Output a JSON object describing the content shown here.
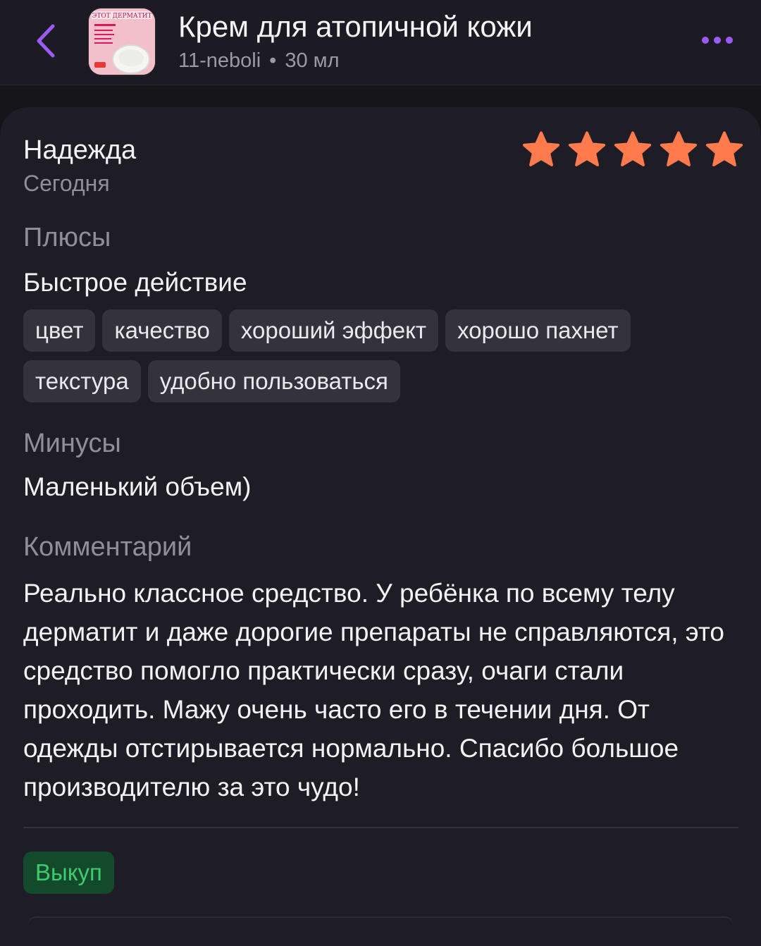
{
  "header": {
    "back_icon": "chevron-left-icon",
    "product_title": "Крем для атопичной кожи",
    "seller": "11-neboli",
    "separator": "•",
    "volume": "30 мл",
    "thumbnail_text": "ЭТОТ ДЕРМАТИТ",
    "more_icon": "more-dots-icon",
    "accent_color": "#9b5cf6"
  },
  "review": {
    "author": "Надежда",
    "date": "Сегодня",
    "rating": 5,
    "rating_max": 5,
    "star_color": "#ff7a4d",
    "pros_label": "Плюсы",
    "pros_text": "Быстрое действие",
    "tags": [
      "цвет",
      "качество",
      "хороший эффект",
      "хорошо пахнет",
      "текстура",
      "удобно пользоваться"
    ],
    "cons_label": "Минусы",
    "cons_text": "Маленький объем)",
    "comment_label": "Комментарий",
    "comment_text": "Реально классное средство. У ребёнка по всему телу дерматит и даже дорогие препараты не справляются, это средство помогло практически сразу, очаги стали проходить. Мажу очень часто его в течении дня. От одежды отстирывается нормально. Спасибо большое производителю за это чудо!",
    "badge": "Выкуп",
    "badge_color": "#3ecb6c"
  }
}
